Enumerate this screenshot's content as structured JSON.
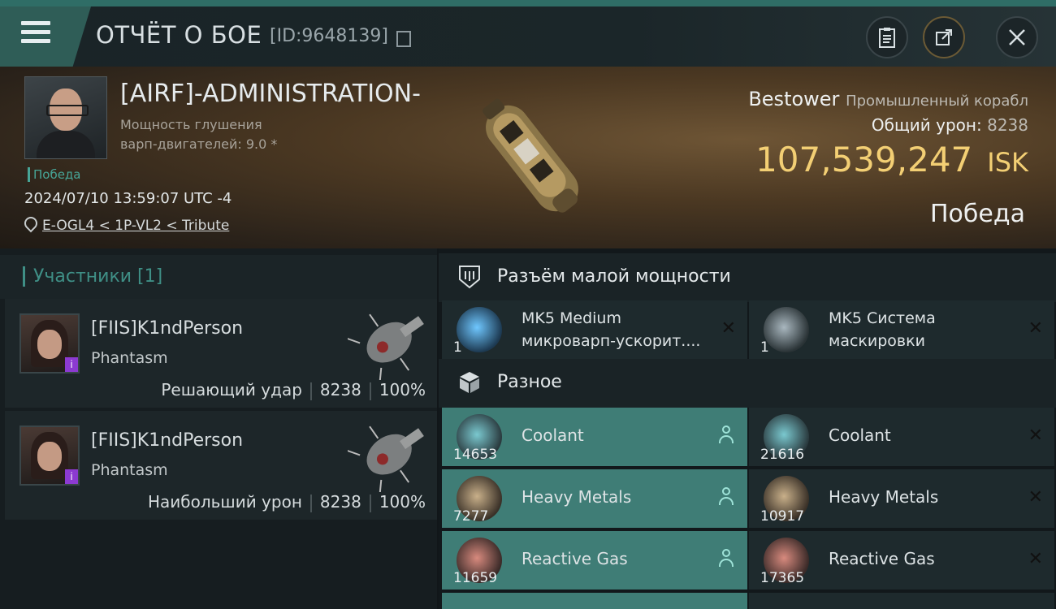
{
  "header": {
    "title": "ОТЧЁТ О БОЕ",
    "report_id": "[ID:9648139]"
  },
  "victim": {
    "name": "[AIRF]-ADMINISTRATION-",
    "stat_line1": "Мощность глушения",
    "stat_line2": "варп-двигателей: 9.0 *",
    "victory_tag": "Победа",
    "datetime": "2024/07/10 13:59:07 UTC -4",
    "location": "E-OGL4 < 1P-VL2 < Tribute"
  },
  "ship": {
    "name": "Bestower",
    "class": "Промышленный корабл",
    "total_damage_label": "Общий урон:",
    "total_damage": "8238",
    "isk_value": "107,539,247",
    "isk_unit": "ISK",
    "result": "Победа"
  },
  "participants": {
    "header": "Участники [1]",
    "rows": [
      {
        "name": "[FIIS]K1ndPerson",
        "ship": "Phantasm",
        "role": "Решающий удар",
        "damage": "8238",
        "percent": "100%"
      },
      {
        "name": "[FIIS]K1ndPerson",
        "ship": "Phantasm",
        "role": "Наибольший урон",
        "damage": "8238",
        "percent": "100%"
      }
    ]
  },
  "sections": {
    "low_slot": {
      "label": "Разъём малой мощности",
      "items": [
        {
          "qty": "1",
          "name_line1": "MK5 Medium",
          "name_line2": "микроварп-ускорит...."
        },
        {
          "qty": "1",
          "name_line1": "MK5 Система",
          "name_line2": "маскировки"
        }
      ]
    },
    "misc": {
      "label": "Разное",
      "items": [
        {
          "qty": "14653",
          "name": "Coolant"
        },
        {
          "qty": "21616",
          "name": "Coolant"
        },
        {
          "qty": "7277",
          "name": "Heavy Metals"
        },
        {
          "qty": "10917",
          "name": "Heavy Metals"
        },
        {
          "qty": "11659",
          "name": "Reactive Gas"
        },
        {
          "qty": "17365",
          "name": "Reactive Gas"
        }
      ]
    }
  },
  "colors": {
    "accent_teal": "#3f7d76",
    "isk_gold": "#f3cf74",
    "victory_green": "#47a597"
  },
  "icons": {
    "menu": "hamburger-icon",
    "copy": "copy-icon",
    "clipboard": "clipboard-icon",
    "share": "share-icon",
    "close": "close-icon",
    "location": "location-pin-icon",
    "low_slot": "low-slot-icon",
    "misc": "cube-icon",
    "dropped": "user-icon",
    "destroyed": "x-icon"
  }
}
